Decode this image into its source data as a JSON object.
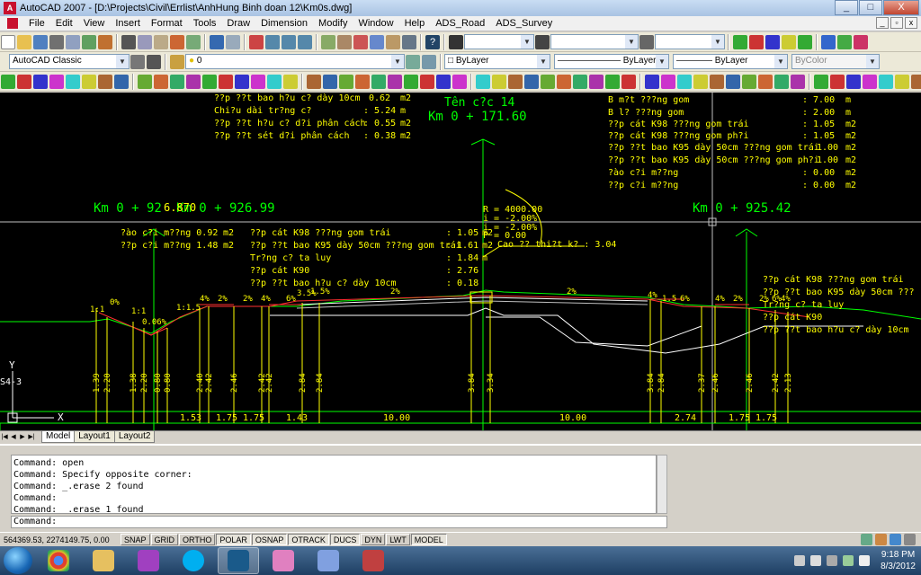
{
  "window": {
    "title": "AutoCAD 2007 - [D:\\Projects\\Civil\\Errlist\\AnhHung Binh doan 12\\Km0s.dwg]",
    "app_icon_letter": "A",
    "min_label": "_",
    "max_label": "□",
    "close_label": "X"
  },
  "menu": {
    "items": [
      "File",
      "Edit",
      "View",
      "Insert",
      "Format",
      "Tools",
      "Draw",
      "Dimension",
      "Modify",
      "Window",
      "Help",
      "ADS_Road",
      "ADS_Survey"
    ],
    "mdi_min": "_",
    "mdi_restore": "▫",
    "mdi_close": "x"
  },
  "toolbars": {
    "workspace": "AutoCAD Classic",
    "layer": "0",
    "color": "ByLayer",
    "linetype": "ByLayer",
    "lineweight": "ByLayer",
    "plotstyle": "ByColor"
  },
  "drawing": {
    "top_table": [
      {
        "label": "??p ??t bao h?u c? dày 10cm",
        "value": "0.62",
        "unit": "m2"
      },
      {
        "label": "Chi?u dài tr?ng c?",
        "value": ": 5.24",
        "unit": "m"
      },
      {
        "label": "??p ??t h?u c? d?i phân cách",
        "value": ": 0.55",
        "unit": "m2"
      },
      {
        "label": "??p ??t sét d?i phân cách",
        "value": ": 0.38",
        "unit": "m2"
      }
    ],
    "station_name": "Tên c?c 14",
    "station_km": "Km 0 + 171.60",
    "right_table": [
      {
        "label": "B m?t ???ng gom",
        "value": ": 7.00",
        "unit": "m"
      },
      {
        "label": "B l? ???ng gom",
        "value": ": 2.00",
        "unit": "m"
      },
      {
        "label": "??p cát K98 ???ng gom trái",
        "value": ": 1.05",
        "unit": "m2"
      },
      {
        "label": "??p cát K98 ???ng gom ph?i",
        "value": ": 1.05",
        "unit": "m2"
      },
      {
        "label": "??p ??t bao K95 dày 50cm ???ng gom trái",
        "value": "1.00",
        "unit": "m2"
      },
      {
        "label": "??p ??t bao K95 dày 50cm ???ng gom ph?i",
        "value": "1.00",
        "unit": "m2"
      },
      {
        "label": "?ào c?i m??ng",
        "value": ": 0.00",
        "unit": "m2"
      },
      {
        "label": "??p c?i m??ng",
        "value": ": 0.00",
        "unit": "m2"
      }
    ],
    "km_left_a": "Km 0 + 92",
    "km_left_b": "Km 0 + 926.99",
    "km_left_overlap": "6.870",
    "km_right": "Km 0 + 925.42",
    "curve": {
      "r": "R = 4000.00",
      "i1": "i = -2.00%",
      "i2": "i = -2.00%",
      "p": "P = 0.00"
    },
    "design_elev": "Cao ?? thi?t k? : 3.04",
    "left_small": [
      {
        "label": "?ào c?i m??ng 0.92",
        "unit": "m2"
      },
      {
        "label": "??p c?i m??ng 1.48",
        "unit": "m2"
      }
    ],
    "mid_table": [
      {
        "label": "??p cát K98 ???ng gom trái",
        "value": ": 1.05",
        "unit": "m2"
      },
      {
        "label": "??p ??t bao K95 dày 50cm ???ng gom trái",
        "value": ": 1.61",
        "unit": "m2"
      },
      {
        "label": "Tr?ng c? ta luy",
        "value": ": 1.84",
        "unit": "m"
      },
      {
        "label": "??p cát K90",
        "value": ": 2.76",
        "unit": ""
      },
      {
        "label": "??p ??t bao h?u c? dày 10cm",
        "value": ": 0.18",
        "unit": ""
      }
    ],
    "right_small": [
      "??p cát K98 ???ng gom trái",
      "??p ??t bao K95 dày 50cm ???",
      "Tr?ng c? ta luy",
      "??p cát K90",
      "??p ??t bao h?u c? dày 10cm"
    ],
    "slopes": [
      "1:1",
      "0%",
      "1:1",
      "0.06%",
      "1:1.5",
      "4%",
      "2%",
      "2%",
      "4%",
      "6%",
      "3.5%",
      "1.5%",
      "2%",
      "2%",
      "4%",
      "1.5",
      "6%",
      "4%",
      "2%",
      "2%",
      "6%",
      "4%"
    ],
    "bottom_widths": [
      "1.53",
      "1.75",
      "1.75",
      "1.43",
      "10.00",
      "10.00",
      "2.74",
      "1.75",
      "1.75"
    ],
    "vertical_elevs": [
      "1.39",
      "2.20",
      "1.38",
      "2.20",
      "0.80",
      "0.80",
      "2.40",
      "2.42",
      "2.46",
      "2.42",
      "2.42",
      "2.84",
      "2.84",
      "3.84",
      "3.34",
      "3.84",
      "2.84",
      "2.37",
      "2.46",
      "2.46",
      "2.42",
      "2.13"
    ],
    "axis_y": "Y",
    "axis_x": "X",
    "axis_label": "S4-3"
  },
  "tabs": {
    "nav": [
      "|◀",
      "◀",
      "▶",
      "▶|"
    ],
    "items": [
      "Model",
      "Layout1",
      "Layout2"
    ]
  },
  "command": {
    "lines": [
      "Command: open",
      "Command: Specify opposite corner:",
      "Command: _.erase 2 found",
      "Command:",
      "Command: _.erase 1 found"
    ],
    "prompt": "Command:"
  },
  "status": {
    "coords": "564369.53, 2274149.75, 0.00",
    "buttons": [
      {
        "label": "SNAP",
        "on": false
      },
      {
        "label": "GRID",
        "on": false
      },
      {
        "label": "ORTHO",
        "on": false
      },
      {
        "label": "POLAR",
        "on": true
      },
      {
        "label": "OSNAP",
        "on": true
      },
      {
        "label": "OTRACK",
        "on": true
      },
      {
        "label": "DUCS",
        "on": true
      },
      {
        "label": "DYN",
        "on": false
      },
      {
        "label": "LWT",
        "on": false
      },
      {
        "label": "MODEL",
        "on": true
      }
    ]
  },
  "taskbar": {
    "time": "9:18 PM",
    "date": "8/3/2012"
  },
  "colors": {
    "canvas": "#000000",
    "annotation": "#ffff00",
    "station": "#00ff00",
    "design_line": "#ff0000"
  }
}
